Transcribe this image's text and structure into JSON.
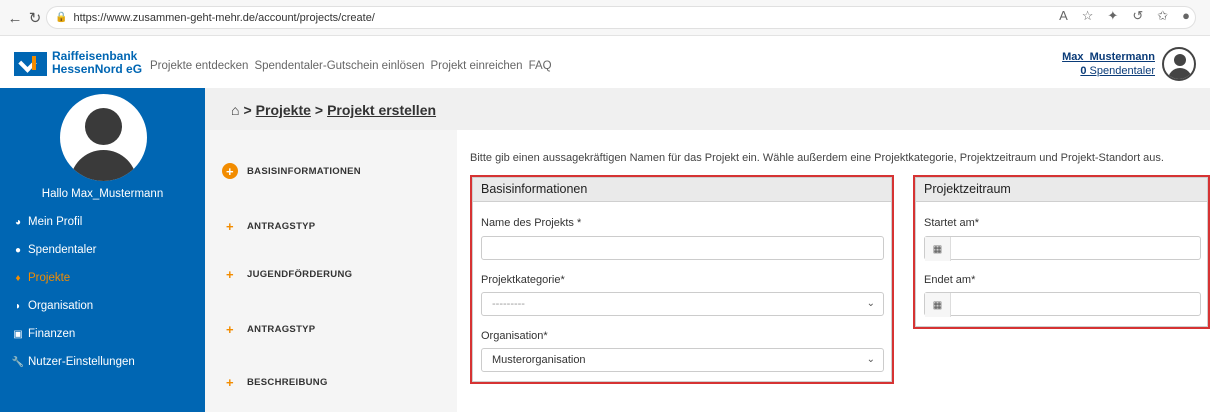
{
  "browser": {
    "url": "https://www.zusammen-geht-mehr.de/account/projects/create/"
  },
  "header": {
    "brand_line1": "Raiffeisenbank",
    "brand_line2": "HessenNord eG",
    "nav": [
      "Projekte entdecken",
      "Spendentaler-Gutschein einlösen",
      "Projekt einreichen",
      "FAQ"
    ],
    "username": "Max_Mustermann",
    "credits_count": "0",
    "credits_label": "Spendentaler"
  },
  "sidebar": {
    "greeting": "Hallo Max_Mustermann",
    "items": [
      {
        "label": "Mein Profil",
        "icon": "dashboard-icon"
      },
      {
        "label": "Spendentaler",
        "icon": "coin-icon"
      },
      {
        "label": "Projekte",
        "icon": "map-pin-icon",
        "active": true
      },
      {
        "label": "Organisation",
        "icon": "shield-icon"
      },
      {
        "label": "Finanzen",
        "icon": "money-icon"
      },
      {
        "label": "Nutzer-Einstellungen",
        "icon": "wrench-icon"
      }
    ]
  },
  "breadcrumb": {
    "separator": ">",
    "items": [
      "Projekte",
      "Projekt erstellen"
    ]
  },
  "steps": [
    "BASISINFORMATIONEN",
    "ANTRAGSTYP",
    "JUGENDFÖRDERUNG",
    "ANTRAGSTYP",
    "BESCHREIBUNG"
  ],
  "intro": "Bitte gib einen aussagekräftigen Namen für das Projekt ein. Wähle außerdem eine Projektkategorie, Projektzeitraum und Projekt-Standort aus.",
  "basis": {
    "title": "Basisinformationen",
    "name_label": "Name des Projekts *",
    "name_value": "",
    "category_label": "Projektkategorie*",
    "category_value": "---------",
    "org_label": "Organisation*",
    "org_value": "Musterorganisation"
  },
  "period": {
    "title": "Projektzeitraum",
    "start_label": "Startet am*",
    "end_label": "Endet am*"
  },
  "colors": {
    "brand_blue": "#0066b3",
    "accent_orange": "#f28c00",
    "highlight_red": "#d63333"
  }
}
